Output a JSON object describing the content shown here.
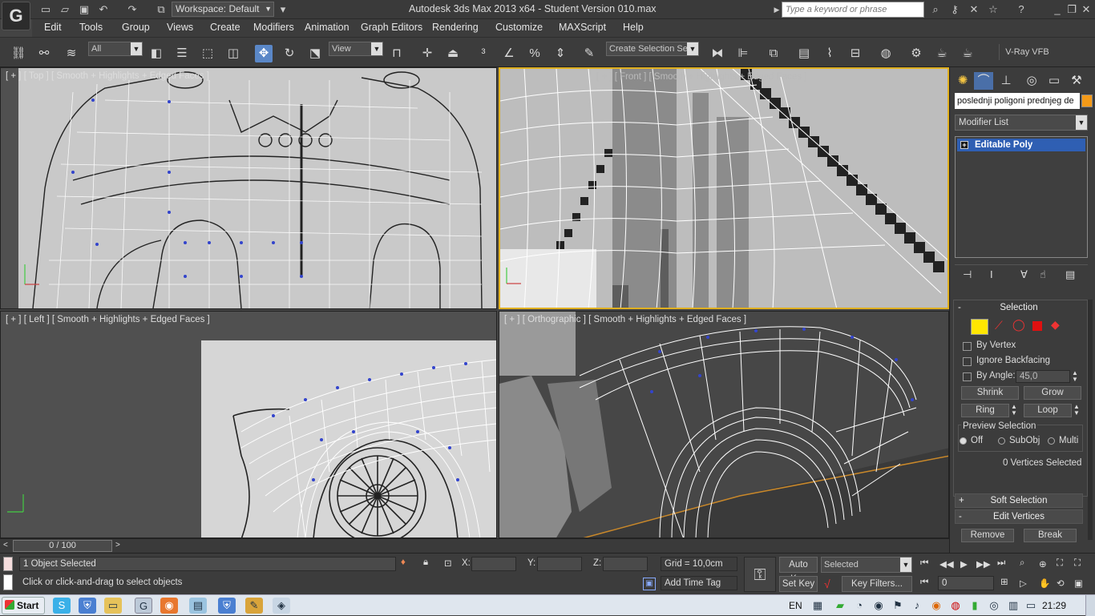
{
  "titlebar": {
    "workspace": "Workspace: Default",
    "title": "Autodesk 3ds Max  2013 x64   - Student Version     010.max",
    "search_placeholder": "Type a keyword or phrase"
  },
  "menu": [
    "Edit",
    "Tools",
    "Group",
    "Views",
    "Create",
    "Modifiers",
    "Animation",
    "Graph Editors",
    "Rendering",
    "Customize",
    "MAXScript",
    "Help"
  ],
  "toolbar": {
    "filter": "All",
    "ref_coord": "View",
    "selection_set": "Create Selection Se",
    "vray_vfb": "V-Ray VFB"
  },
  "viewports": {
    "top": "[ + ] [ Top ] [ Smooth + Highlights + Edged Faces ]",
    "front": "[ + ] [ Front ] [ Smooth + Highlights + Edged Faces ]",
    "left": "[ + ] [ Left ] [ Smooth + Highlights + Edged Faces ]",
    "perspective": "[ + ] [ Orthographic ] [ Smooth + Highlights + Edged Faces ]"
  },
  "command_panel": {
    "object_name": "poslednji poligoni prednjeg de",
    "modifier_list": "Modifier List",
    "stack_item": "Editable Poly",
    "selection": {
      "title": "Selection",
      "by_vertex": "By Vertex",
      "ignore_backfacing": "Ignore Backfacing",
      "by_angle": "By Angle:",
      "angle_value": "45,0",
      "shrink": "Shrink",
      "grow": "Grow",
      "ring": "Ring",
      "loop": "Loop",
      "preview_selection": "Preview Selection",
      "off": "Off",
      "subobj": "SubObj",
      "multi": "Multi",
      "status": "0 Vertices Selected"
    },
    "soft_selection": "Soft Selection",
    "edit_vertices": "Edit Vertices",
    "remove": "Remove",
    "break": "Break"
  },
  "timeslider": {
    "frame": "0 / 100"
  },
  "status": {
    "objects_selected": "1 Object Selected",
    "prompt": "Click or click-and-drag to select objects",
    "x_label": "X:",
    "y_label": "Y:",
    "z_label": "Z:",
    "grid": "Grid = 10,0cm",
    "add_time_tag": "Add Time Tag",
    "auto_key": "Auto Key",
    "set_key": "Set Key",
    "selected": "Selected",
    "key_filters": "Key Filters...",
    "frame_value": "0"
  },
  "taskbar": {
    "start": "Start",
    "lang": "EN",
    "clock": "21:29"
  },
  "colors": {
    "accent": "#5a87c7",
    "stack_highlight": "#2f5fb3",
    "object_color": "#f49a18"
  }
}
